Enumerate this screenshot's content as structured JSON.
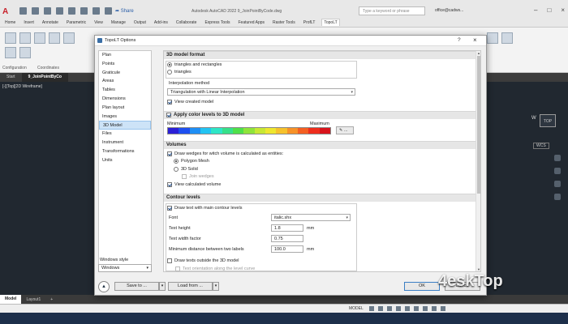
{
  "app": {
    "logo": "A",
    "share_label": "Share",
    "title": "Autodesk AutoCAD 2022  9_JoinPointByCode.dwg",
    "search_placeholder": "Type a keyword or phrase",
    "account": "office@cadws..."
  },
  "ribbon_tabs": [
    "Home",
    "Insert",
    "Annotate",
    "Parametric",
    "View",
    "Manage",
    "Output",
    "Add-ins",
    "Collaborate",
    "Express Tools",
    "Featured Apps",
    "Raster Tools",
    "ProfLT",
    "TopoLT"
  ],
  "ribbon_active_tab": "TopoLT",
  "ribbon_panel_labels": [
    "Configuration",
    "Coordinates"
  ],
  "document_tabs": [
    "Start",
    "9_JoinPointByCo"
  ],
  "viewport": {
    "label": "[-][Top][2D Wireframe]",
    "viewcube_face": "TOP",
    "viewcube_west": "W",
    "wcs": "WCS"
  },
  "layout_tabs": [
    "Model",
    "Layout1",
    "+"
  ],
  "status": {
    "model": "MODEL"
  },
  "dialog": {
    "title": "TopoLT Options",
    "help": "?",
    "close": "×",
    "nav_items": [
      "Plan",
      "Points",
      "Graticule",
      "Areas",
      "Tables",
      "Dimensions",
      "Plan layout",
      "Images",
      "3D Model",
      "Files",
      "Instrument",
      "Transformations",
      "Units"
    ],
    "nav_selected": "3D Model",
    "windows_style_label": "Windows style",
    "windows_style_value": "Windows",
    "sections": {
      "model_format": "3D model format",
      "apply_colors": "Apply color levels to 3D model",
      "volumes": "Volumes",
      "contour_levels": "Contour levels"
    },
    "model_format": {
      "opt_triangles_rectangles": "triangles and rectangles",
      "opt_triangles": "triangles",
      "interp_label": "Interpolation method",
      "interp_value": "Triangulation with Linear Interpolation",
      "view_created": "View created model"
    },
    "colors": {
      "minimum": "Minimum",
      "maximum": "Maximum",
      "gradient": [
        "#2b1fd6",
        "#1e4ff0",
        "#1f8ff5",
        "#23c4f2",
        "#2ee6c6",
        "#37e08a",
        "#4fe04a",
        "#8fe43b",
        "#c7e835",
        "#eee72f",
        "#f6c22c",
        "#f79228",
        "#f45f22",
        "#ee2e1d",
        "#d8141c"
      ]
    },
    "volumes": {
      "draw_wedges": "Draw wedges for witch volume is calculated as entities:",
      "polygon_mesh": "Polygon Mesh",
      "solid_3d": "3D Solid",
      "join_wedges": "Join wedges",
      "view_calculated": "View calculated volume"
    },
    "contours": {
      "draw_text": "Draw text with main contour levels",
      "font_label": "Font",
      "font_value": "italic.shx",
      "text_height_label": "Text height",
      "text_height_value": "1.8",
      "text_height_unit": "mm",
      "text_width_label": "Text width factor",
      "text_width_value": "0.75",
      "min_distance_label": "Minimum distance between two labels",
      "min_distance_value": "100.0",
      "min_distance_unit": "mm",
      "outside_3d": "Draw texts outside the 3D model",
      "orientation": "Text orientation along the level curve"
    },
    "buttons": {
      "save_to": "Save to ...",
      "load_from": "Load from ...",
      "ok": "OK",
      "cancel": "Cancel",
      "split_arrow": "▾"
    }
  },
  "watermark": "4eskTop"
}
